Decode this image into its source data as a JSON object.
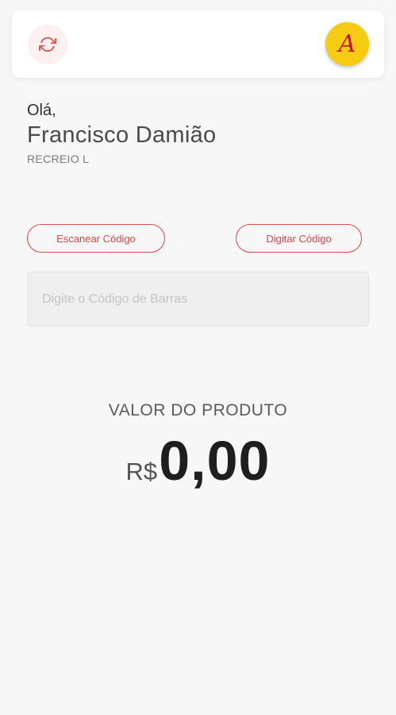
{
  "header": {
    "refresh_icon": "refresh-icon",
    "logo_letter": "A",
    "colors": {
      "logo_background": "#f5cc12",
      "logo_letter": "#c8102e",
      "refresh_icon": "#e05a5a"
    }
  },
  "greeting": {
    "hello": "Olá,",
    "name": "Francisco Damião",
    "store": "RECREIO L"
  },
  "actions": {
    "scan_label": "Escanear Código",
    "type_label": "Digitar Código",
    "accent": "#d64a4a"
  },
  "barcode": {
    "placeholder": "Digite o Código de Barras",
    "value": ""
  },
  "price": {
    "label": "VALOR DO PRODUTO",
    "currency": "R$",
    "amount": "0,00"
  }
}
